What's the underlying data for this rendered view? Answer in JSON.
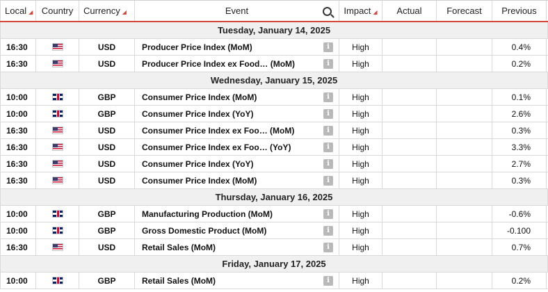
{
  "header": {
    "local": "Local",
    "country": "Country",
    "currency": "Currency",
    "event": "Event",
    "impact": "Impact",
    "actual": "Actual",
    "forecast": "Forecast",
    "previous": "Previous",
    "sort_glyph": "◢"
  },
  "days": [
    {
      "date": "Tuesday, January 14, 2025",
      "events": [
        {
          "time": "16:30",
          "flag": "us",
          "currency": "USD",
          "event": "Producer Price Index (MoM)",
          "impact": "High",
          "actual": "",
          "forecast": "",
          "previous": "0.4%"
        },
        {
          "time": "16:30",
          "flag": "us",
          "currency": "USD",
          "event": "Producer Price Index ex Food…  (MoM)",
          "impact": "High",
          "actual": "",
          "forecast": "",
          "previous": "0.2%"
        }
      ]
    },
    {
      "date": "Wednesday, January 15, 2025",
      "events": [
        {
          "time": "10:00",
          "flag": "gb",
          "currency": "GBP",
          "event": "Consumer Price Index (MoM)",
          "impact": "High",
          "actual": "",
          "forecast": "",
          "previous": "0.1%"
        },
        {
          "time": "10:00",
          "flag": "gb",
          "currency": "GBP",
          "event": "Consumer Price Index (YoY)",
          "impact": "High",
          "actual": "",
          "forecast": "",
          "previous": "2.6%"
        },
        {
          "time": "16:30",
          "flag": "us",
          "currency": "USD",
          "event": "Consumer Price Index ex Foo…  (MoM)",
          "impact": "High",
          "actual": "",
          "forecast": "",
          "previous": "0.3%"
        },
        {
          "time": "16:30",
          "flag": "us",
          "currency": "USD",
          "event": "Consumer Price Index ex Foo…  (YoY)",
          "impact": "High",
          "actual": "",
          "forecast": "",
          "previous": "3.3%"
        },
        {
          "time": "16:30",
          "flag": "us",
          "currency": "USD",
          "event": "Consumer Price Index (YoY)",
          "impact": "High",
          "actual": "",
          "forecast": "",
          "previous": "2.7%"
        },
        {
          "time": "16:30",
          "flag": "us",
          "currency": "USD",
          "event": "Consumer Price Index (MoM)",
          "impact": "High",
          "actual": "",
          "forecast": "",
          "previous": "0.3%"
        }
      ]
    },
    {
      "date": "Thursday, January 16, 2025",
      "events": [
        {
          "time": "10:00",
          "flag": "gb",
          "currency": "GBP",
          "event": "Manufacturing Production (MoM)",
          "impact": "High",
          "actual": "",
          "forecast": "",
          "previous": "-0.6%"
        },
        {
          "time": "10:00",
          "flag": "gb",
          "currency": "GBP",
          "event": "Gross Domestic Product (MoM)",
          "impact": "High",
          "actual": "",
          "forecast": "",
          "previous": "-0.100"
        },
        {
          "time": "16:30",
          "flag": "us",
          "currency": "USD",
          "event": "Retail Sales (MoM)",
          "impact": "High",
          "actual": "",
          "forecast": "",
          "previous": "0.7%"
        }
      ]
    },
    {
      "date": "Friday, January 17, 2025",
      "events": [
        {
          "time": "10:00",
          "flag": "gb",
          "currency": "GBP",
          "event": "Retail Sales (MoM)",
          "impact": "High",
          "actual": "",
          "forecast": "",
          "previous": "0.2%"
        }
      ]
    }
  ],
  "info_glyph": "i",
  "colors": {
    "accent": "#d6463b",
    "date_row_bg": "#f0f0f0",
    "info_bg": "#b9b9b9"
  }
}
